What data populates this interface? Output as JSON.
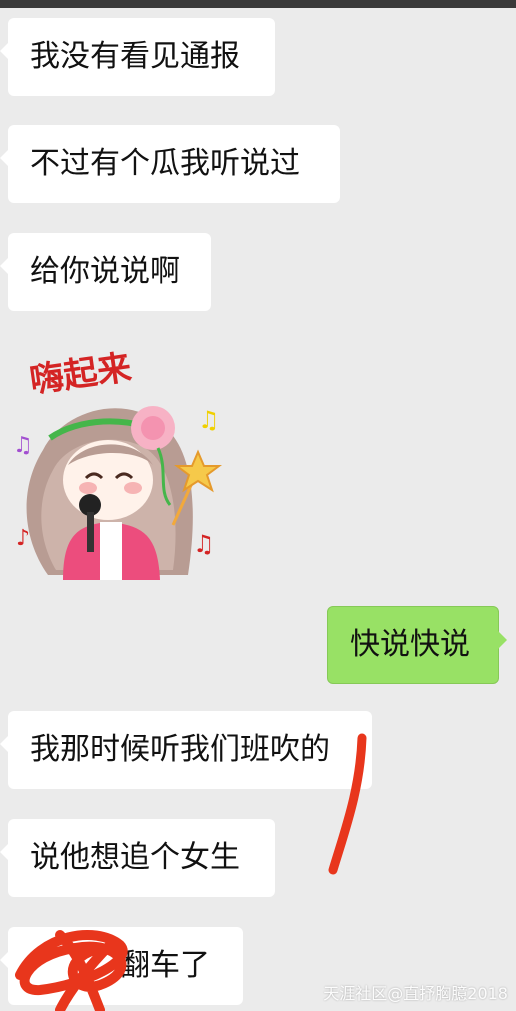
{
  "messages": [
    {
      "side": "left",
      "text": "我没有看见通报"
    },
    {
      "side": "left",
      "text": "不过有个瓜我听说过"
    },
    {
      "side": "left",
      "text": "给你说说啊"
    },
    {
      "side": "right",
      "text": "快说快说"
    },
    {
      "side": "left",
      "text": "我那时候听我们班吹的"
    },
    {
      "side": "left",
      "text": "说他想追个女生"
    },
    {
      "side": "left",
      "text": "翻车了"
    }
  ],
  "sticker": {
    "caption": "嗨起来",
    "icon": "singing-girl-sticker"
  },
  "watermark": "天涯社区@直抒胸臆2018",
  "colors": {
    "background": "#ebebeb",
    "incoming": "#ffffff",
    "outgoing": "#98e165",
    "redaction": "#e8361c"
  }
}
